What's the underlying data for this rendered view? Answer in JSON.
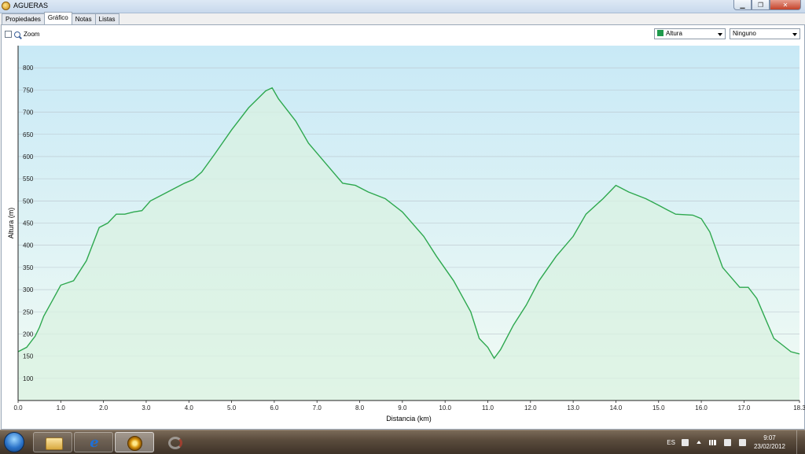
{
  "window": {
    "title": "AGUERAS",
    "min_label": "▁",
    "max_label": "❐",
    "close_label": "✕"
  },
  "tabs": [
    {
      "label": "Propiedades"
    },
    {
      "label": "Gráfico"
    },
    {
      "label": "Notas"
    },
    {
      "label": "Listas"
    }
  ],
  "toolbar": {
    "zoom_label": "Zoom",
    "series_select": "Altura",
    "series_color": "#1f9a4c",
    "secondary_select": "Ninguno"
  },
  "colors": {
    "line": "#2ea84f",
    "fill_top": "#d9f2e2",
    "bg_top": "#c8e9f6",
    "bg_bottom": "#f2fbf4",
    "grid": "#b9c4cc"
  },
  "chart_data": {
    "type": "area",
    "xlabel": "Distancia  (km)",
    "ylabel": "Altura (m)",
    "xlim": [
      0,
      18.3
    ],
    "ylim": [
      50,
      850
    ],
    "xticks": [
      "0.0",
      "1.0",
      "2.0",
      "3.0",
      "4.0",
      "5.0",
      "6.0",
      "7.0",
      "8.0",
      "9.0",
      "10.0",
      "11.0",
      "12.0",
      "13.0",
      "14.0",
      "15.0",
      "16.0",
      "17.0",
      "18.3"
    ],
    "xtick_values": [
      0,
      1,
      2,
      3,
      4,
      5,
      6,
      7,
      8,
      9,
      10,
      11,
      12,
      13,
      14,
      15,
      16,
      17,
      18.3
    ],
    "yticks": [
      100,
      150,
      200,
      250,
      300,
      350,
      400,
      450,
      500,
      550,
      600,
      650,
      700,
      750,
      800
    ],
    "grid": true,
    "series": [
      {
        "name": "Altura",
        "x": [
          0,
          0.2,
          0.4,
          0.5,
          0.6,
          0.8,
          1.0,
          1.3,
          1.6,
          1.9,
          2.1,
          2.3,
          2.5,
          2.7,
          2.9,
          3.1,
          3.4,
          3.7,
          3.9,
          4.1,
          4.3,
          4.6,
          5.0,
          5.4,
          5.8,
          5.95,
          6.1,
          6.5,
          6.8,
          7.2,
          7.6,
          7.9,
          8.2,
          8.6,
          9.0,
          9.5,
          9.8,
          10.2,
          10.6,
          10.8,
          11.0,
          11.15,
          11.3,
          11.6,
          11.9,
          12.2,
          12.6,
          13.0,
          13.3,
          13.7,
          14.0,
          14.1,
          14.3,
          14.7,
          15.0,
          15.2,
          15.4,
          15.8,
          16.0,
          16.2,
          16.5,
          16.9,
          17.1,
          17.3,
          17.5,
          17.7,
          17.9,
          18.1,
          18.3
        ],
        "values": [
          160,
          170,
          195,
          215,
          240,
          275,
          310,
          320,
          365,
          440,
          450,
          470,
          470,
          475,
          478,
          500,
          515,
          530,
          540,
          548,
          565,
          605,
          660,
          710,
          748,
          755,
          730,
          680,
          630,
          585,
          540,
          535,
          520,
          505,
          475,
          420,
          375,
          320,
          250,
          190,
          170,
          145,
          165,
          220,
          265,
          320,
          375,
          420,
          470,
          505,
          535,
          530,
          520,
          505,
          490,
          480,
          470,
          468,
          460,
          430,
          350,
          305,
          305,
          280,
          235,
          190,
          175,
          160,
          155
        ]
      }
    ]
  }
}
